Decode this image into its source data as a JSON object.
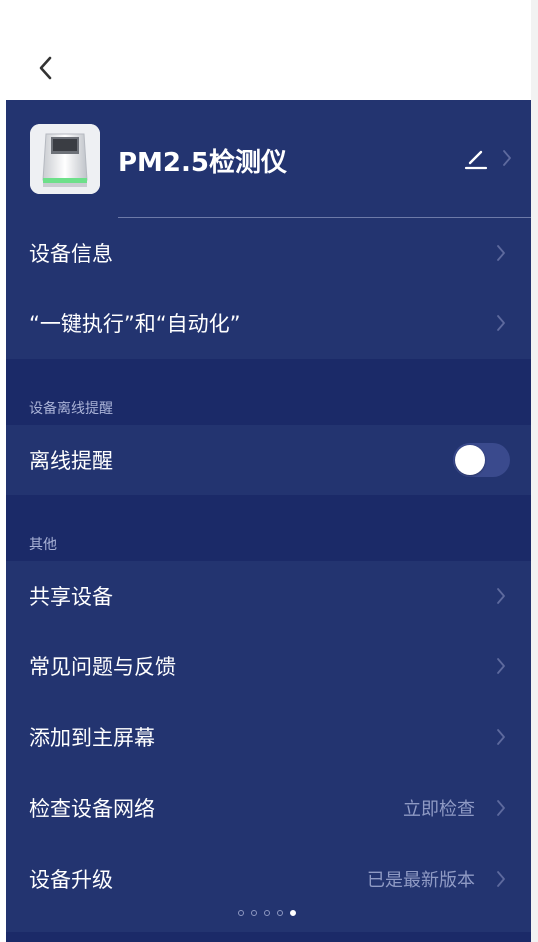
{
  "colors": {
    "background": "#1b2a68",
    "card": "#233470",
    "text": "#ffffff",
    "secondary_text": "#8f9ac4",
    "section_label": "#a9b2d6",
    "top_bar": "#ffffff"
  },
  "nav": {
    "back_icon": "chevron-left-icon"
  },
  "device": {
    "name": "PM2.5检测仪",
    "icon": "air-quality-monitor-icon",
    "edit_icon": "pencil-icon"
  },
  "main": {
    "items": [
      {
        "label": "设备信息"
      },
      {
        "label": "“一键执行”和“自动化”"
      }
    ]
  },
  "offline": {
    "section_title": "设备离线提醒",
    "toggle_label": "离线提醒",
    "enabled": false
  },
  "other": {
    "section_title": "其他",
    "items": [
      {
        "label": "共享设备",
        "value": ""
      },
      {
        "label": "常见问题与反馈",
        "value": ""
      },
      {
        "label": "添加到主屏幕",
        "value": ""
      },
      {
        "label": "检查设备网络",
        "value": "立即检查"
      },
      {
        "label": "设备升级",
        "value": "已是最新版本"
      }
    ]
  },
  "pager": {
    "count": 5,
    "active_index": 4
  }
}
